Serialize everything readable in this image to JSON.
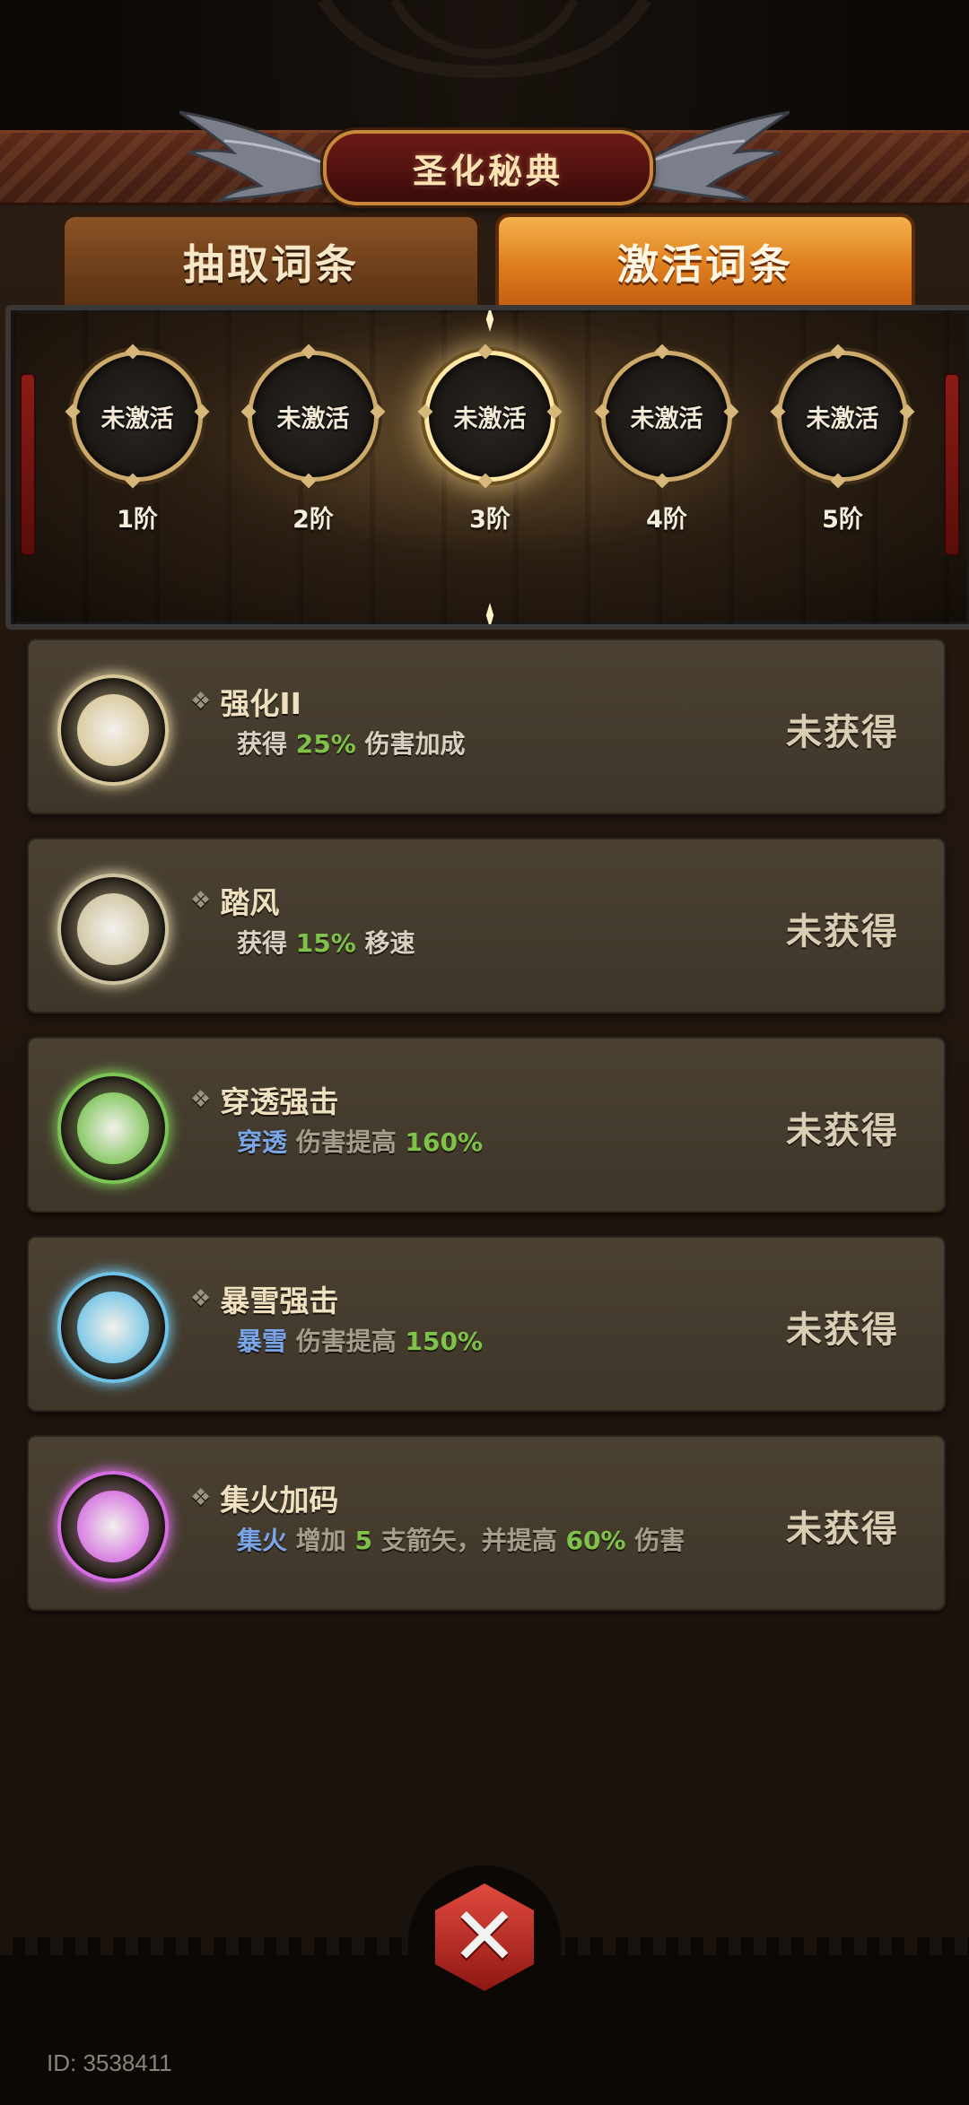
{
  "header": {
    "title": "圣化秘典"
  },
  "tabs": [
    {
      "label": "抽取词条",
      "active": false
    },
    {
      "label": "激活词条",
      "active": true
    }
  ],
  "tiers": [
    {
      "state": "未激活",
      "label": "1阶"
    },
    {
      "state": "未激活",
      "label": "2阶"
    },
    {
      "state": "未激活",
      "label": "3阶",
      "selected": true
    },
    {
      "state": "未激活",
      "label": "4阶"
    },
    {
      "state": "未激活",
      "label": "5阶"
    }
  ],
  "entries": [
    {
      "title": "强化II",
      "desc": [
        {
          "t": "获得 ",
          "c": ""
        },
        {
          "t": "25%",
          "c": "green"
        },
        {
          "t": " 伤害加成",
          "c": ""
        }
      ],
      "status": "未获得",
      "orb_color": "#d8c79a"
    },
    {
      "title": "踏风",
      "desc": [
        {
          "t": "获得 ",
          "c": ""
        },
        {
          "t": "15%",
          "c": "green"
        },
        {
          "t": " 移速",
          "c": ""
        }
      ],
      "status": "未获得",
      "orb_color": "#cfc4a0"
    },
    {
      "title": "穿透强击",
      "desc": [
        {
          "t": "穿透",
          "c": "blue"
        },
        {
          "t": " 伤害提高 ",
          "c": "dim"
        },
        {
          "t": "160%",
          "c": "green"
        }
      ],
      "status": "未获得",
      "orb_color": "#7cc456"
    },
    {
      "title": "暴雪强击",
      "desc": [
        {
          "t": "暴雪",
          "c": "blue"
        },
        {
          "t": " 伤害提高 ",
          "c": "dim"
        },
        {
          "t": "150%",
          "c": "green"
        }
      ],
      "status": "未获得",
      "orb_color": "#6fc3e6"
    },
    {
      "title": "集火加码",
      "desc": [
        {
          "t": "集火",
          "c": "blue"
        },
        {
          "t": " 增加 ",
          "c": "dim"
        },
        {
          "t": "5",
          "c": "green"
        },
        {
          "t": " 支箭矢，并提高 ",
          "c": "dim"
        },
        {
          "t": "60%",
          "c": "green"
        },
        {
          "t": " 伤害",
          "c": "dim"
        }
      ],
      "status": "未获得",
      "orb_color": "#d46ee0"
    }
  ],
  "footer": {
    "user_id": "ID: 3538411"
  },
  "icons": {
    "close": "close-icon",
    "bullet": "diamond-bullet-icon"
  },
  "colors": {
    "highlight_green": "#7fc24a",
    "highlight_blue": "#7aa6e8",
    "active_tab": "#dd7d1e",
    "close_button": "#c8281f"
  }
}
